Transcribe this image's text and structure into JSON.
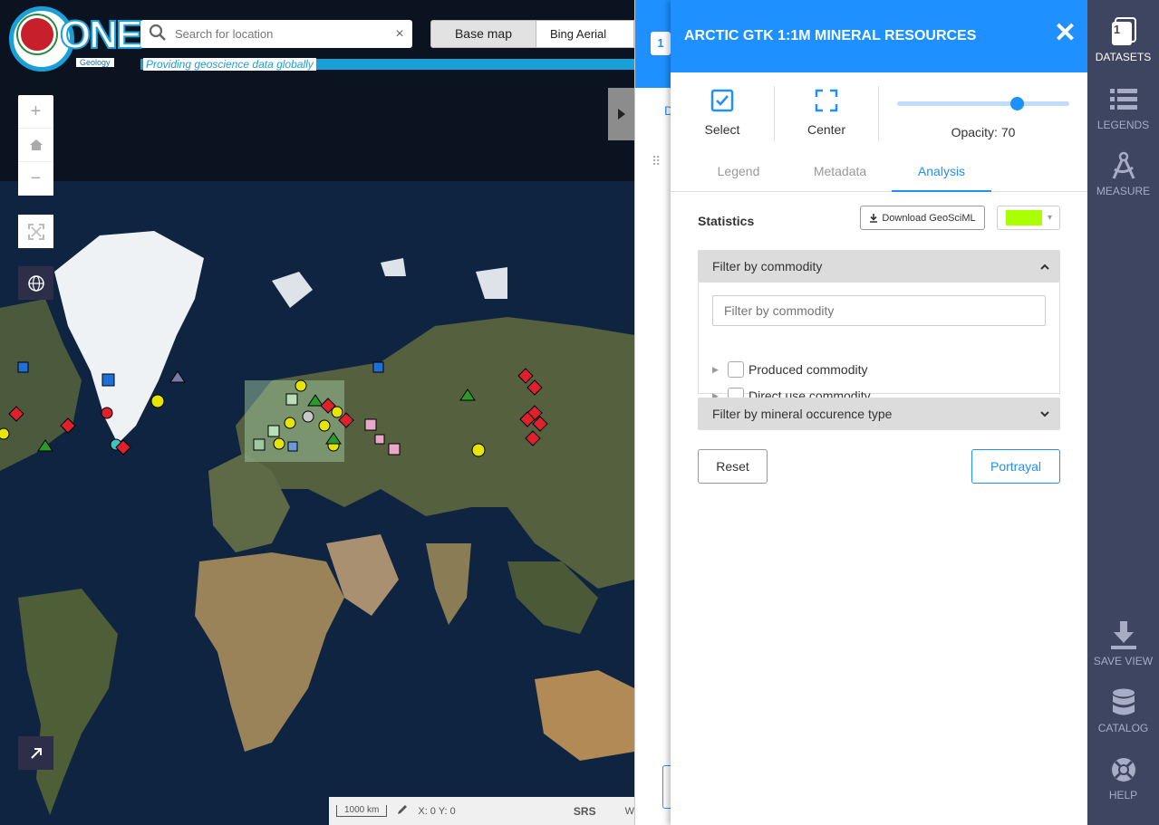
{
  "header": {
    "logo_text": "ONE",
    "logo_sub": "Geology",
    "tagline": "Providing geoscience data globally",
    "search_placeholder": "Search for location",
    "basemap_label": "Base map",
    "basemap_value": "Bing Aerial"
  },
  "statusbar": {
    "scale": "1000 km",
    "coords": "X: 0 Y: 0",
    "srs": "SRS",
    "cut": "W"
  },
  "back_panel": {
    "badge": "1",
    "tab_letter": "D"
  },
  "panel": {
    "title": "ARCTIC GTK 1:1M MINERAL RESOURCES",
    "tools": {
      "select": "Select",
      "center": "Center",
      "opacity_label": "Opacity: 70",
      "opacity_value": 70
    },
    "tabs": [
      "Legend",
      "Metadata",
      "Analysis"
    ],
    "active_tab": "Analysis",
    "statistics_title": "Statistics",
    "download_label": "Download GeoSciML",
    "color": "#aaff00",
    "filter_commodity": {
      "header": "Filter by commodity",
      "placeholder": "Filter by commodity",
      "items": [
        "Produced commodity",
        "Direct use commodity"
      ]
    },
    "filter_occurrence": {
      "header": "Filter by mineral occurence type"
    },
    "reset_label": "Reset",
    "portrayal_label": "Portrayal"
  },
  "sidebar": {
    "badge": "1",
    "items": [
      {
        "label": "DATASETS",
        "icon": "datasets-icon"
      },
      {
        "label": "LEGENDS",
        "icon": "legends-icon"
      },
      {
        "label": "MEASURE",
        "icon": "measure-icon"
      },
      {
        "label": "SAVE VIEW",
        "icon": "download-icon"
      },
      {
        "label": "CATALOG",
        "icon": "database-icon"
      },
      {
        "label": "HELP",
        "icon": "lifebuoy-icon"
      }
    ]
  },
  "colors": {
    "primary": "#1e90ff",
    "sidebar_bg": "#3d4560",
    "accent": "#1aa0d8"
  }
}
